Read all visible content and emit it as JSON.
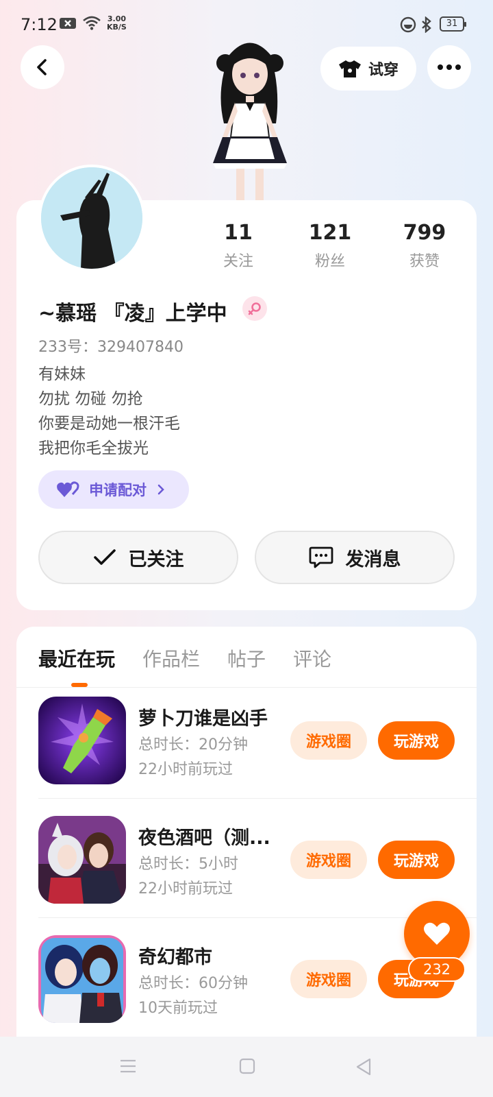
{
  "status_bar": {
    "time": "7:12",
    "speed_value": "3.00",
    "speed_unit": "KB/S",
    "battery": "31"
  },
  "header": {
    "tryon_label": "试穿"
  },
  "profile": {
    "stats": [
      {
        "value": "11",
        "label": "关注"
      },
      {
        "value": "121",
        "label": "粉丝"
      },
      {
        "value": "799",
        "label": "获赞"
      }
    ],
    "username": "~慕瑶 『凌』上学中",
    "uid": "233号：329407840",
    "bio": [
      "有妹妹",
      "勿扰 勿碰 勿抢",
      "你要是动她一根汗毛",
      "我把你毛全拔光"
    ],
    "pair_label": "申请配对",
    "follow_label": "已关注",
    "message_label": "发消息"
  },
  "tabs": [
    "最近在玩",
    "作品栏",
    "帖子",
    "评论"
  ],
  "games": [
    {
      "name": "萝卜刀谁是凶手",
      "time": "总时长：20分钟",
      "last": "22小时前玩过"
    },
    {
      "name": "夜色酒吧（测...",
      "time": "总时长：5小时",
      "last": "22小时前玩过"
    },
    {
      "name": "奇幻都市",
      "time": "总时长：60分钟",
      "last": "10天前玩过"
    }
  ],
  "game_buttons": {
    "circle": "游戏圈",
    "play": "玩游戏"
  },
  "like_count": "232",
  "colors": {
    "accent": "#ff6a00",
    "pair": "#6b59d6"
  }
}
